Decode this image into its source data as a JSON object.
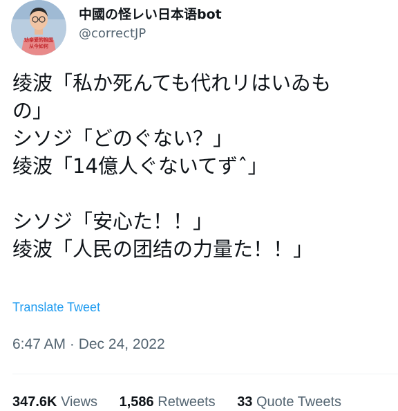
{
  "author": {
    "display_name": "中國の怪レい日本语bot",
    "handle": "@correctJP",
    "avatar_caption": "劝亲爱的祖国 从今如何"
  },
  "tweet": {
    "lines": [
      "绫波「私か死んても代れリはいゐも",
      "の」",
      "シソジ「どのぐない？」",
      "绫波「14億人ぐないてずˆ」",
      "",
      "シソジ「安心た！！」",
      "绫波「人民の团结の力量た！！」"
    ],
    "translate_label": "Translate Tweet",
    "timestamp": "6:47 AM · Dec 24, 2022"
  },
  "stats": {
    "views_count": "347.6K",
    "views_label": "Views",
    "retweets_count": "1,586",
    "retweets_label": "Retweets",
    "quotes_count": "33",
    "quotes_label": "Quote Tweets"
  },
  "colors": {
    "text_primary": "#0f1419",
    "text_secondary": "#536471",
    "link": "#1d9bf0",
    "divider": "#eff3f4"
  }
}
